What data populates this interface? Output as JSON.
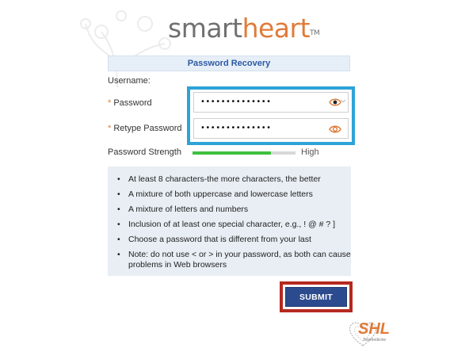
{
  "logo": {
    "smart": "smart",
    "heart": "heart",
    "tm": "TM"
  },
  "form": {
    "header": "Password Recovery",
    "username_label": "Username:",
    "required_marker": "*",
    "password_label": "Password",
    "retype_label": "Retype Password",
    "password_value": "••••••••••••••",
    "retype_value": "••••••••••••••",
    "strength_label": "Password Strength",
    "strength_value": "High",
    "strength_fraction": 0.76
  },
  "rules": [
    "At least 8 characters-the more characters, the better",
    "A mixture of both uppercase and lowercase letters",
    "A mixture of letters and numbers",
    "Inclusion of at least one special character, e.g., ! @ # ? ]",
    "Choose a password that is different from your last",
    "Note: do not use < or > in your password, as both can cause problems in Web browsers"
  ],
  "submit_label": "SUBMIT",
  "footer_logo": {
    "text": "SHL",
    "subtitle": "Telemedicine"
  },
  "colors": {
    "brand_orange": "#e07b39",
    "header_blue": "#2d5aa3",
    "highlight_blue": "#2ea3d6",
    "highlight_red": "#b5291f",
    "submit_bg": "#2c4b8e",
    "strength_green": "#3fbf3f"
  },
  "icons": [
    "eye-icon",
    "chevron-down-icon",
    "heart-logo-icon"
  ]
}
